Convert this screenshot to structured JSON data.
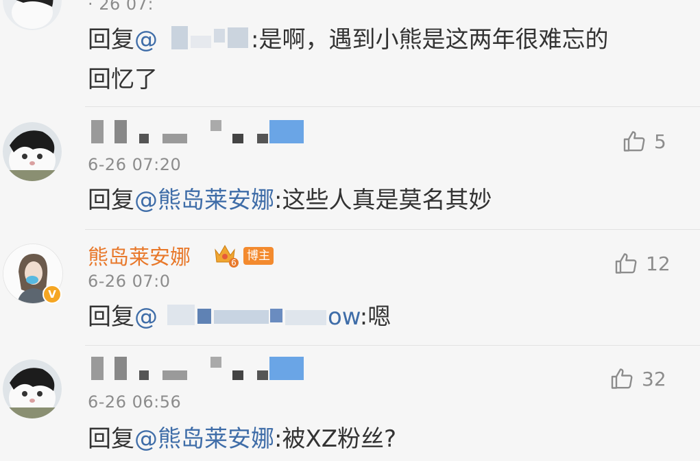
{
  "colors": {
    "mention": "#3f6da8",
    "vip_name": "#e8782a",
    "badge": "#f38a2e",
    "meta": "#8c8c8c"
  },
  "comments": [
    {
      "time": "· 26 07:",
      "reply_prefix": "回复",
      "mention": "@    ",
      "text_line1": ":是啊，遇到小熊是这两年很难忘的",
      "text_line2": "回忆了"
    },
    {
      "time": "6-26 07:20",
      "likes": "5",
      "reply_prefix": "回复",
      "mention": "@熊岛莱安娜",
      "text": ":这些人真是莫名其妙"
    },
    {
      "author": "熊岛莱安娜",
      "level": "6",
      "badge": "博主",
      "time": "6-26 07:0",
      "likes": "12",
      "reply_prefix": "回复",
      "mention_tail": "ow",
      "text": ":嗯"
    },
    {
      "time": "6-26 06:56",
      "likes": "32",
      "reply_prefix": "回复",
      "mention": "@熊岛莱安娜",
      "text": ":被XZ粉丝?"
    }
  ]
}
